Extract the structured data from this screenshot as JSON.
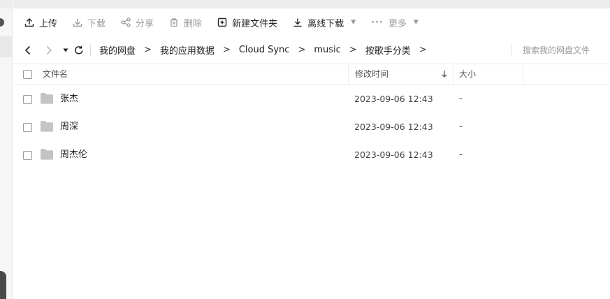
{
  "toolbar": {
    "upload": "上传",
    "download": "下载",
    "share": "分享",
    "delete": "删除",
    "new_folder": "新建文件夹",
    "offline_download": "离线下载",
    "more": "更多"
  },
  "nav": {
    "breadcrumbs": [
      "我的网盘",
      "我的应用数据",
      "Cloud Sync",
      "music",
      "按歌手分类"
    ],
    "separator": ">",
    "search_placeholder": "搜索我的网盘文件"
  },
  "table": {
    "headers": {
      "name": "文件名",
      "mtime": "修改时间",
      "size": "大小"
    },
    "rows": [
      {
        "name": "张杰",
        "mtime": "2023-09-06 12:43",
        "size": "-"
      },
      {
        "name": "周深",
        "mtime": "2023-09-06 12:43",
        "size": "-"
      },
      {
        "name": "周杰伦",
        "mtime": "2023-09-06 12:43",
        "size": "-"
      }
    ]
  },
  "icons": {
    "upload": "upload-icon",
    "download": "download-icon",
    "share": "share-icon",
    "delete": "trash-icon",
    "new_folder": "new-folder-icon",
    "offline_download": "offline-download-icon",
    "more": "more-dots-icon",
    "folder": "folder-icon"
  },
  "colors": {
    "folder": "#c4c4c4",
    "disabled_text": "#9a9a9a",
    "border": "#ececec"
  }
}
